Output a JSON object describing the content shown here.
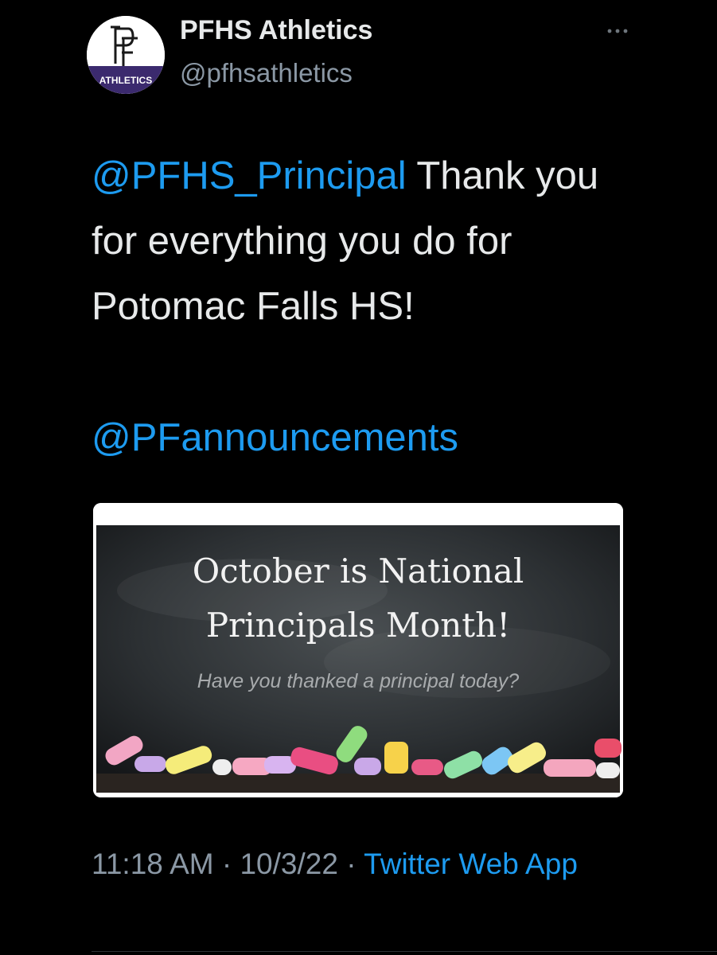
{
  "tweet": {
    "author": {
      "display_name": "PFHS Athletics",
      "handle": "@pfhsathletics",
      "avatar": {
        "monogram": "PF",
        "banner_text": "ATHLETICS",
        "banner_color": "#3b2a6e"
      }
    },
    "more_icon": "ellipsis-icon",
    "text": {
      "mention_1": "@PFHS_Principal",
      "body": " Thank you for everything you do for Potomac Falls HS!",
      "mention_2": "@PFannouncements"
    },
    "media": {
      "headline_line1": "October is National",
      "headline_line2": "Principals Month!",
      "subline": "Have you thanked a principal today?"
    },
    "meta": {
      "time": "11:18 AM",
      "separator": "·",
      "date": "10/3/22",
      "source": "Twitter Web App"
    }
  },
  "colors": {
    "background": "#000000",
    "text": "#e7e9ea",
    "secondary": "#8b98a5",
    "link": "#1d9bf0"
  }
}
